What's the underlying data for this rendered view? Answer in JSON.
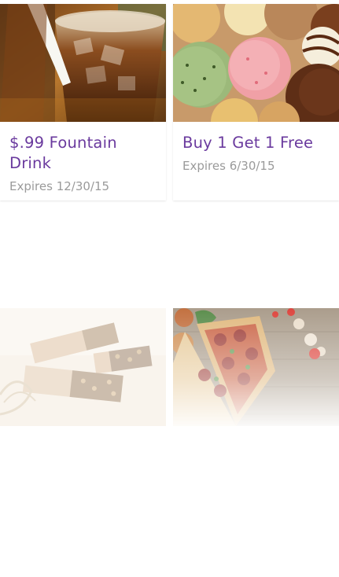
{
  "offers": [
    {
      "title": "$.99 Fountain Drink",
      "expires": "Expires 12/30/15",
      "image": "fountain-drink-photo"
    },
    {
      "title": "Buy 1 Get 1 Free",
      "expires": "Expires 6/30/15",
      "image": "ice-cream-photo"
    },
    {
      "title": "",
      "expires": "",
      "image": "granola-bars-photo"
    },
    {
      "title": "",
      "expires": "",
      "image": "pizza-photo"
    }
  ],
  "colors": {
    "title": "#6a3a9e",
    "expires": "#9a9a9a",
    "background": "#ffffff"
  }
}
